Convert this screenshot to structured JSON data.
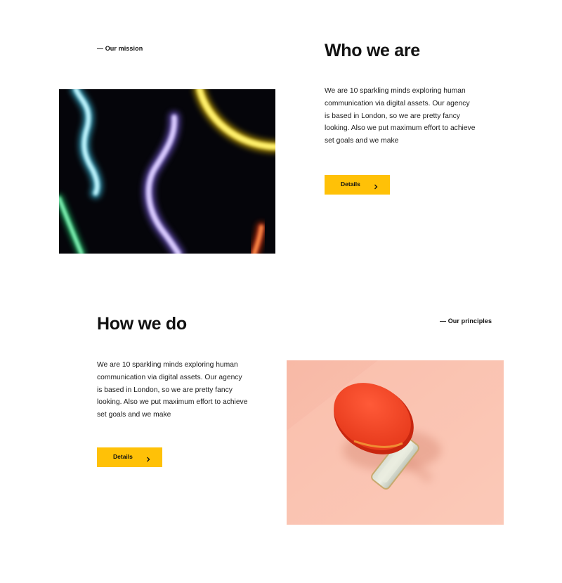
{
  "who": {
    "eyebrow": "— Our mission",
    "title": "Who we are",
    "body": "We are 10 sparkling minds exploring human communication via digital assets. Our agency is based in London, so we are pretty fancy looking. Also we put maximum effort to achieve set goals and we make",
    "button_label": "Details",
    "button_icon": "chevron-right-icon",
    "image_subject": "neon-light-squiggles"
  },
  "how": {
    "eyebrow": "— Our principles",
    "title": "How we do",
    "body": "We are 10 sparkling minds exploring human communication via digital assets. Our agency is based in London, so we are pretty fancy looking. Also we put maximum effort to achieve set goals and we make",
    "button_label": "Details",
    "button_icon": "chevron-right-icon",
    "image_subject": "ping-pong-paddle"
  },
  "colors": {
    "accent": "#ffc107",
    "text": "#111111",
    "background": "#ffffff"
  }
}
